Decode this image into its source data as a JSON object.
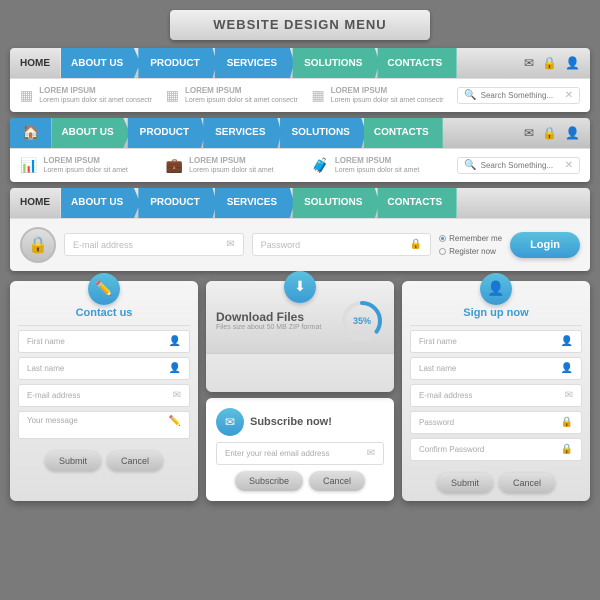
{
  "title": {
    "text": "WEBSITE",
    "accent": "DESIGN MENU"
  },
  "nav1": {
    "items": [
      "HOME",
      "ABOUT US",
      "PRODUCT",
      "SERVICES",
      "SOLUTIONS",
      "CONTACTS"
    ],
    "icons": [
      "✉",
      "🔒",
      "👤"
    ]
  },
  "nav1_sub": {
    "items": [
      {
        "label": "LOREM IPSUM",
        "desc": "Lorem ipsum dolor sit amet consectr"
      },
      {
        "label": "LOREM IPSUM",
        "desc": "Lorem ipsum dolor sit amet consectr"
      },
      {
        "label": "LOREM IPSUM",
        "desc": "Lorem ipsum dolor sit amet consectr"
      }
    ],
    "search_placeholder": "Search Something..."
  },
  "nav2": {
    "items": [
      "ABOUT US",
      "PRODUCT",
      "SERVICES",
      "SOLUTIONS",
      "CONTACTS"
    ],
    "icons": [
      "✉",
      "🔒",
      "👤"
    ]
  },
  "nav2_sub": {
    "items": [
      {
        "label": "LOREM IPSUM",
        "desc": "Lorem ipsum dolor sit amet"
      },
      {
        "label": "LOREM IPSUM",
        "desc": "Lorem ipsum dolor sit amet"
      },
      {
        "label": "LOREM IPSUM",
        "desc": "Lorem ipsum dolor sit amet"
      }
    ],
    "search_placeholder": "Search Something..."
  },
  "nav3": {
    "items": [
      "HOME",
      "ABOUT US",
      "PRODUCT",
      "SERVICES",
      "SOLUTIONS",
      "CONTACTS"
    ]
  },
  "login": {
    "email_placeholder": "E-mail address",
    "password_placeholder": "Password",
    "remember_me": "Remember me",
    "register": "Register now",
    "button": "Login"
  },
  "contact_widget": {
    "title": "Contact us",
    "fields": [
      "First name",
      "Last name",
      "E-mail address",
      "Your message"
    ],
    "submit": "Submit",
    "cancel": "Cancel"
  },
  "download_widget": {
    "title": "Download Files",
    "desc": "Files size about 50 MB ZIP format",
    "progress": "35%",
    "progress_value": 35
  },
  "subscribe_widget": {
    "title": "Subscribe now!",
    "placeholder": "Enter your real email address",
    "subscribe_btn": "Subscribe",
    "cancel_btn": "Cancel"
  },
  "signup_widget": {
    "title": "Sign up now",
    "fields": [
      "First name",
      "Last name",
      "E-mail address",
      "Password",
      "Confirm Password"
    ],
    "submit": "Submit",
    "cancel": "Cancel"
  }
}
